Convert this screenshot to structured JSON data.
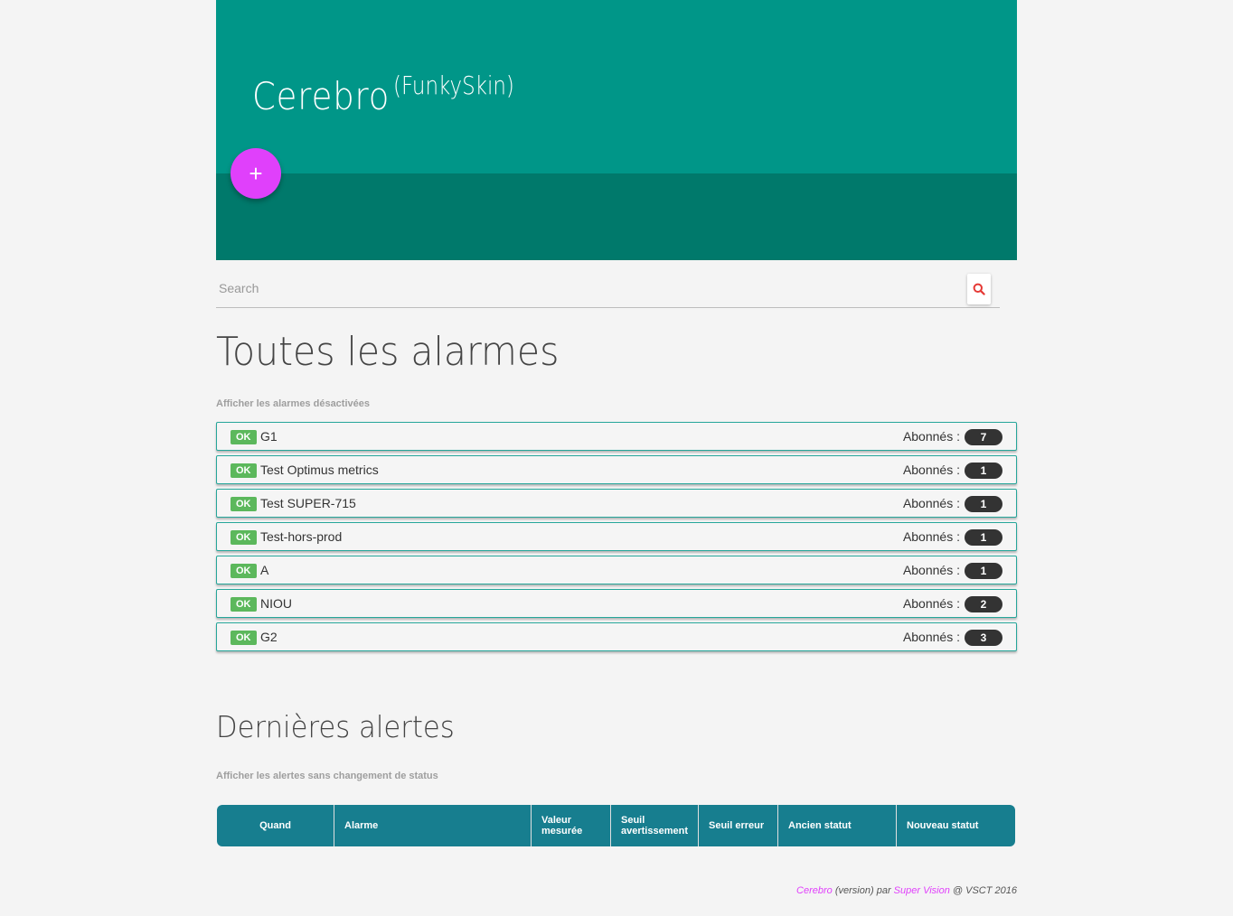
{
  "header": {
    "brand": "Cerebro",
    "brand_sub": "(FunkySkin)",
    "add_button": "+",
    "colors": {
      "primary": "#009688",
      "primary_dark": "#00796b",
      "accent": "#e040fb"
    }
  },
  "search": {
    "placeholder": "Search",
    "value": "",
    "icon": "search-icon",
    "icon_color": "#e53935"
  },
  "alarms": {
    "title": "Toutes les alarmes",
    "toggle_label": "Afficher les alarmes désactivées",
    "subscribers_label": "Abonnés :",
    "status_color": "#5cb85c",
    "items": [
      {
        "status": "OK",
        "name": "G1",
        "subscribers": "7"
      },
      {
        "status": "OK",
        "name": "Test Optimus metrics",
        "subscribers": "1"
      },
      {
        "status": "OK",
        "name": "Test SUPER-715",
        "subscribers": "1"
      },
      {
        "status": "OK",
        "name": "Test-hors-prod",
        "subscribers": "1"
      },
      {
        "status": "OK",
        "name": "A",
        "subscribers": "1"
      },
      {
        "status": "OK",
        "name": "NIOU",
        "subscribers": "2"
      },
      {
        "status": "OK",
        "name": "G2",
        "subscribers": "3"
      }
    ]
  },
  "alerts": {
    "title": "Dernières alertes",
    "toggle_label": "Afficher les alertes sans changement de status",
    "table_color": "#177e8f",
    "columns": [
      "Quand",
      "Alarme",
      "Valeur mesurée",
      "Seuil avertissement",
      "Seuil erreur",
      "Ancien statut",
      "Nouveau statut"
    ],
    "rows": []
  },
  "footer": {
    "app": "Cerebro",
    "version": "(version)",
    "by": "par",
    "team": "Super Vision",
    "copyright": "@ VSCT 2016"
  }
}
